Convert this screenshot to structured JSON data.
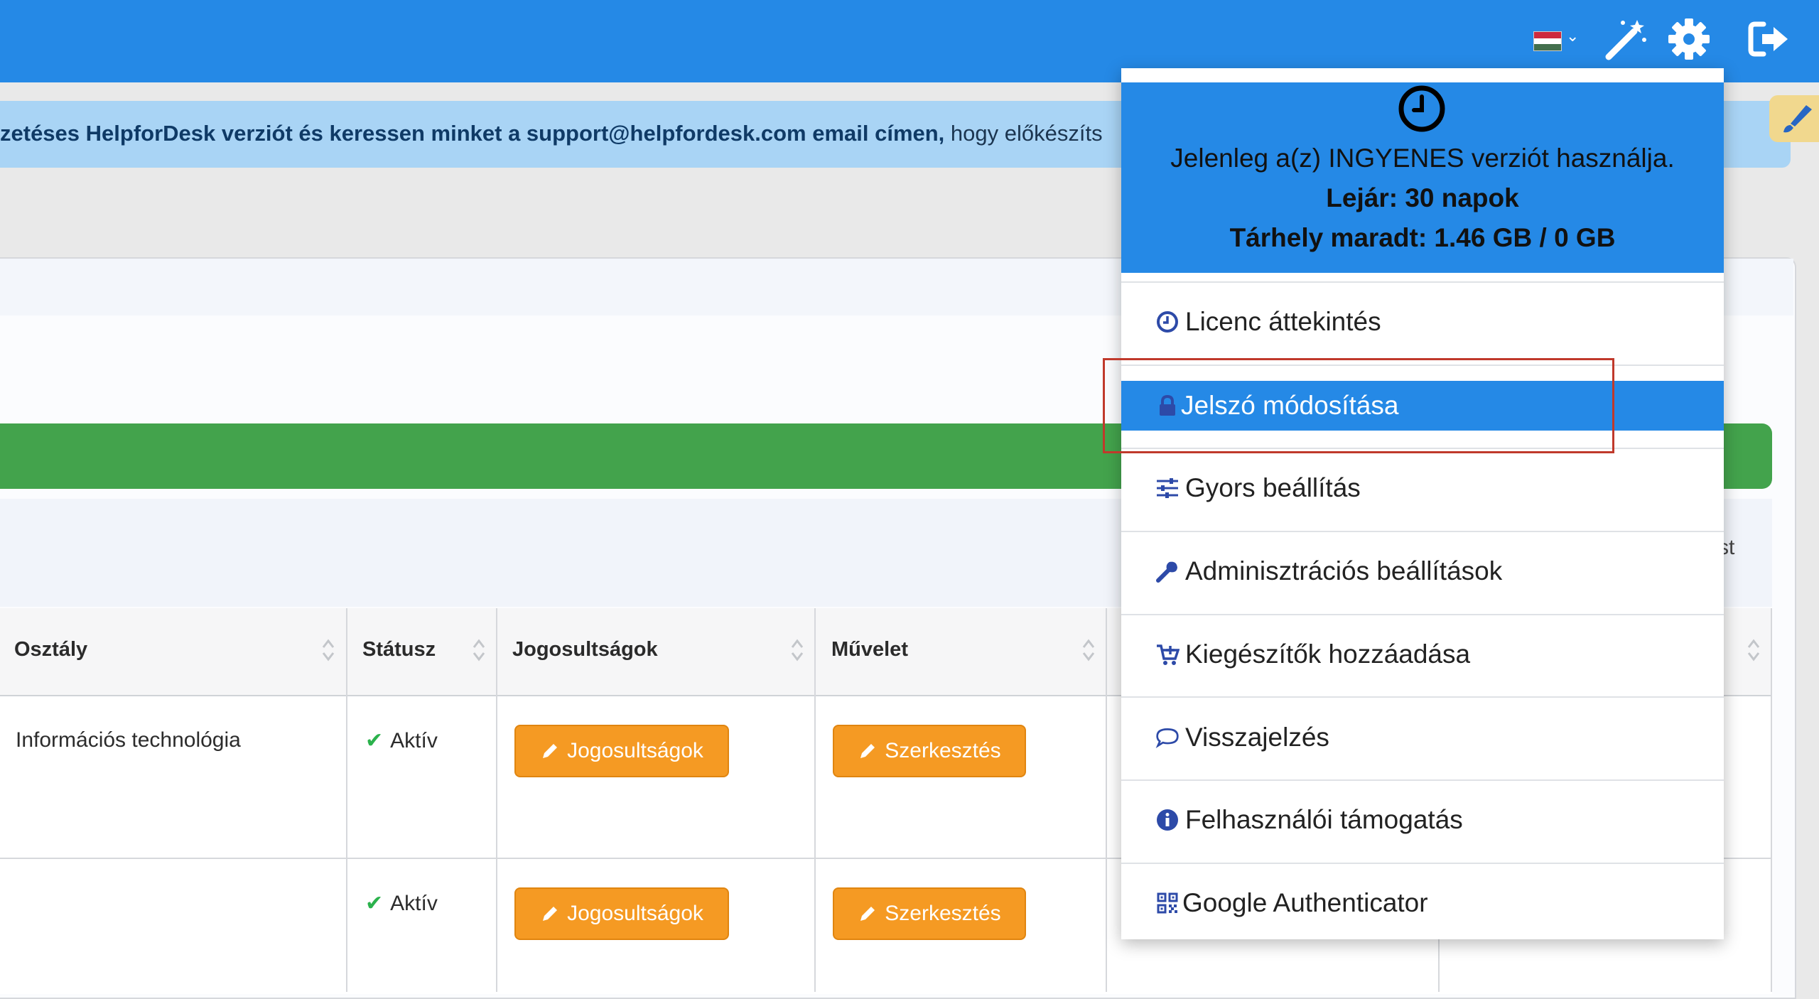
{
  "announcement": {
    "bold_text": "zetéses HelpforDesk verziót és keressen minket a support@helpfordesk.com email címen,",
    "normal_text": " hogy előkészíts"
  },
  "table": {
    "headers": [
      "Osztály",
      "Státusz",
      "Jogosultságok",
      "Művelet"
    ],
    "rows": [
      {
        "department": "Információs technológia",
        "status": "Aktív",
        "permissions_button": "Jogosultságok",
        "edit_button": "Szerkesztés"
      },
      {
        "department": "",
        "status": "Aktív",
        "permissions_button": "Jogosultságok",
        "edit_button": "Szerkesztés"
      }
    ],
    "filter_partial": "st"
  },
  "dropdown": {
    "header": {
      "line1": "Jelenleg a(z) INGYENES verziót használja.",
      "line2": "Lejár: 30 napok",
      "line3": "Tárhely maradt: 1.46 GB / 0 GB"
    },
    "items": [
      {
        "label": "Licenc áttekintés",
        "icon": "clock-icon"
      },
      {
        "label": "Jelszó módosítása",
        "icon": "lock-icon",
        "active": true
      },
      {
        "label": "Gyors beállítás",
        "icon": "sliders-icon"
      },
      {
        "label": "Adminisztrációs beállítások",
        "icon": "wrench-icon"
      },
      {
        "label": "Kiegészítők hozzáadása",
        "icon": "cart-plus-icon"
      },
      {
        "label": "Visszajelzés",
        "icon": "comment-icon"
      },
      {
        "label": "Felhasználói támogatás",
        "icon": "info-icon"
      },
      {
        "label": "Google Authenticator",
        "icon": "qrcode-icon"
      }
    ]
  },
  "colors": {
    "primary": "#2589e6",
    "success": "#43a34c",
    "warning": "#f59a23",
    "highlight": "#c0392b"
  }
}
